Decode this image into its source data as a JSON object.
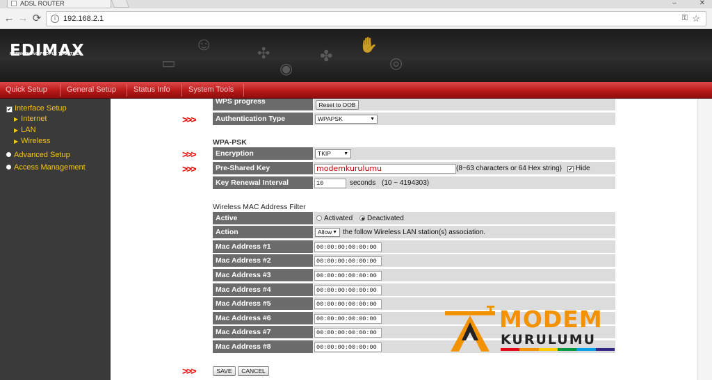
{
  "browser": {
    "tab_title": "ADSL ROUTER",
    "url": "192.168.2.1",
    "back_glyph": "←",
    "forward_glyph": "→",
    "reload_glyph": "⟳",
    "minimize_glyph": "–",
    "close_glyph": "✕",
    "key_glyph": "⚿",
    "star_glyph": "☆"
  },
  "header": {
    "brand": "EDIMAX",
    "tagline": "NETWORKING PEOPLE TOGETHER"
  },
  "menu": {
    "items": [
      "Quick Setup",
      "General Setup",
      "Status Info",
      "System Tools"
    ]
  },
  "sidebar": {
    "interface_setup": "Interface Setup",
    "internet": "Internet",
    "lan": "LAN",
    "wireless": "Wireless",
    "advanced_setup": "Advanced Setup",
    "access_management": "Access Management",
    "checkmark": "✔",
    "triangle": "▶"
  },
  "wps": {
    "label": "WPS progress",
    "reset_button": "Reset to OOB"
  },
  "auth": {
    "label": "Authentication Type",
    "value": "WPAPSK"
  },
  "wpapsk": {
    "section_title": "WPA-PSK",
    "encryption_label": "Encryption",
    "encryption_value": "TKIP",
    "psk_label": "Pre-Shared Key",
    "psk_value": "modemkurulumu",
    "psk_hint": "(8~63 characters or 64 Hex string)",
    "hide_label": "Hide",
    "hide_checked": true,
    "renewal_label": "Key Renewal Interval",
    "renewal_value": "10",
    "renewal_unit": "seconds",
    "renewal_range": "(10 ~ 4194303)"
  },
  "macfilter": {
    "section_title": "Wireless MAC Address Filter",
    "active_label": "Active",
    "activated": "Activated",
    "deactivated": "Deactivated",
    "action_label": "Action",
    "action_value": "Allow",
    "action_note": "the follow Wireless LAN station(s) association.",
    "addresses": [
      {
        "label": "Mac Address #1",
        "value": "00:00:00:00:00:00"
      },
      {
        "label": "Mac Address #2",
        "value": "00:00:00:00:00:00"
      },
      {
        "label": "Mac Address #3",
        "value": "00:00:00:00:00:00"
      },
      {
        "label": "Mac Address #4",
        "value": "00:00:00:00:00:00"
      },
      {
        "label": "Mac Address #5",
        "value": "00:00:00:00:00:00"
      },
      {
        "label": "Mac Address #6",
        "value": "00:00:00:00:00:00"
      },
      {
        "label": "Mac Address #7",
        "value": "00:00:00:00:00:00"
      },
      {
        "label": "Mac Address #8",
        "value": "00:00:00:00:00:00"
      }
    ]
  },
  "buttons": {
    "save": "SAVE",
    "cancel": "CANCEL"
  },
  "annotation": {
    "arrows": ">>>"
  },
  "watermark": {
    "line1": "MODEM",
    "line2": "KURULUMU"
  },
  "colors": {
    "menu_red": "#b91818",
    "sidebar_bg": "#3a3a3a",
    "sidebar_text": "#f5c518",
    "label_bg": "#6b6b6b",
    "value_bg": "#dcdcdc",
    "arrow_red": "#e00000",
    "brand_orange": "#f39200"
  }
}
